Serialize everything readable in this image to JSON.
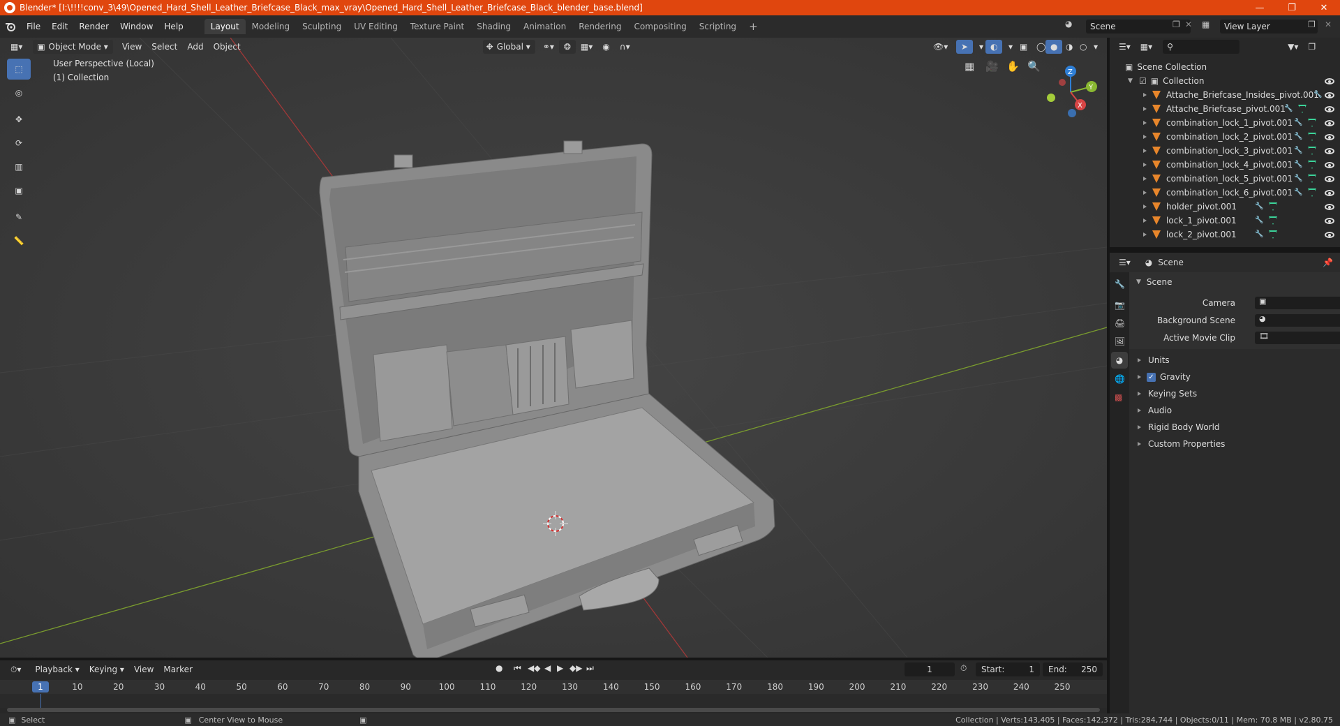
{
  "window": {
    "title": "Blender* [I:\\!!!!conv_3\\49\\Opened_Hard_Shell_Leather_Briefcase_Black_max_vray\\Opened_Hard_Shell_Leather_Briefcase_Black_blender_base.blend]"
  },
  "menu": {
    "items": [
      "File",
      "Edit",
      "Render",
      "Window",
      "Help"
    ]
  },
  "workspaces": [
    "Layout",
    "Modeling",
    "Sculpting",
    "UV Editing",
    "Texture Paint",
    "Shading",
    "Animation",
    "Rendering",
    "Compositing",
    "Scripting"
  ],
  "active_workspace": "Layout",
  "scene_field": "Scene",
  "view_layer_field": "View Layer",
  "viewport": {
    "mode": "Object Mode",
    "menus": [
      "View",
      "Select",
      "Add",
      "Object"
    ],
    "transform_orientation": "Global",
    "overlay_title": "User Perspective (Local)",
    "overlay_sub": "(1) Collection",
    "gizmo_axes": {
      "x": "X",
      "y": "Y",
      "z": "Z"
    }
  },
  "outliner": {
    "scene_collection": "Scene Collection",
    "collection": "Collection",
    "objects": [
      "Attache_Briefcase_Insides_pivot.001",
      "Attache_Briefcase_pivot.001",
      "combination_lock_1_pivot.001",
      "combination_lock_2_pivot.001",
      "combination_lock_3_pivot.001",
      "combination_lock_4_pivot.001",
      "combination_lock_5_pivot.001",
      "combination_lock_6_pivot.001",
      "holder_pivot.001",
      "lock_1_pivot.001",
      "lock_2_pivot.001"
    ]
  },
  "properties": {
    "header_title": "Scene",
    "panel_title": "Scene",
    "camera_label": "Camera",
    "background_scene_label": "Background Scene",
    "active_movie_clip_label": "Active Movie Clip",
    "sections": [
      "Units",
      "Gravity",
      "Keying Sets",
      "Audio",
      "Rigid Body World",
      "Custom Properties"
    ]
  },
  "timeline": {
    "menus": [
      "Playback",
      "Keying",
      "View",
      "Marker"
    ],
    "current_frame": "1",
    "start_label": "Start:",
    "start": "1",
    "end_label": "End:",
    "end": "250",
    "ruler": [
      "1",
      "10",
      "20",
      "30",
      "40",
      "50",
      "60",
      "70",
      "80",
      "90",
      "100",
      "110",
      "120",
      "130",
      "140",
      "150",
      "160",
      "170",
      "180",
      "190",
      "200",
      "210",
      "220",
      "230",
      "240",
      "250"
    ]
  },
  "status": {
    "left": "Select",
    "middle": "Center View to Mouse",
    "right": "Collection | Verts:143,405 | Faces:142,372 | Tris:284,744 | Objects:0/11 | Mem: 70.8 MB | v2.80.75"
  },
  "colors": {
    "title_bar": "#e0460e",
    "accent": "#4772b3",
    "object_icon": "#e8862b",
    "mesh_icon": "#3cd49a"
  }
}
